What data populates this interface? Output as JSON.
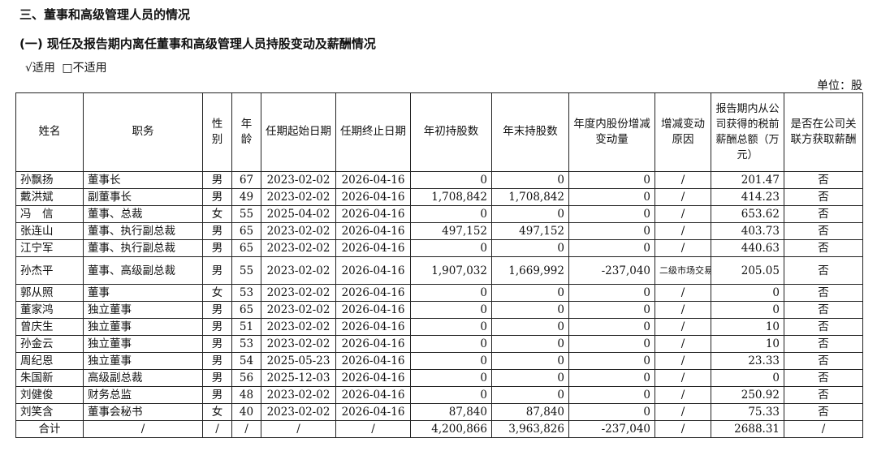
{
  "section_title": "三、董事和高级管理人员的情况",
  "subsection_title": "(一) 现任及报告期内离任董事和高级管理人员持股变动及薪酬情况",
  "applicability": {
    "applicable": "√适用",
    "not_applicable": "□不适用"
  },
  "unit_label": "单位：股",
  "table": {
    "headers": [
      "姓名",
      "职务",
      "性别",
      "年龄",
      "任期起始日期",
      "任期终止日期",
      "年初持股数",
      "年末持股数",
      "年度内股份增减变动量",
      "增减变动原因",
      "报告期内从公司获得的税前薪酬总额（万元）",
      "是否在公司关联方获取薪酬"
    ],
    "rows": [
      [
        "孙飘扬",
        "董事长",
        "男",
        "67",
        "2023-02-02",
        "2026-04-16",
        "0",
        "0",
        "0",
        "/",
        "201.47",
        "否"
      ],
      [
        "戴洪斌",
        "副董事长",
        "男",
        "49",
        "2023-02-02",
        "2026-04-16",
        "1,708,842",
        "1,708,842",
        "0",
        "/",
        "414.23",
        "否"
      ],
      [
        "冯　信",
        "董事、总裁",
        "女",
        "55",
        "2025-04-02",
        "2026-04-16",
        "0",
        "0",
        "0",
        "/",
        "653.62",
        "否"
      ],
      [
        "张连山",
        "董事、执行副总裁",
        "男",
        "65",
        "2023-02-02",
        "2026-04-16",
        "497,152",
        "497,152",
        "0",
        "/",
        "403.73",
        "否"
      ],
      [
        "江宁军",
        "董事、执行副总裁",
        "男",
        "65",
        "2023-02-02",
        "2026-04-16",
        "0",
        "0",
        "0",
        "/",
        "440.63",
        "否"
      ],
      [
        "孙杰平",
        "董事、高级副总裁",
        "男",
        "55",
        "2023-02-02",
        "2026-04-16",
        "1,907,032",
        "1,669,992",
        "-237,040",
        "二级市场交易",
        "205.05",
        "否"
      ],
      [
        "郭从照",
        "董事",
        "女",
        "53",
        "2023-02-02",
        "2026-04-16",
        "0",
        "0",
        "0",
        "/",
        "0",
        "否"
      ],
      [
        "董家鸿",
        "独立董事",
        "男",
        "65",
        "2023-02-02",
        "2026-04-16",
        "0",
        "0",
        "0",
        "/",
        "0",
        "否"
      ],
      [
        "曾庆生",
        "独立董事",
        "男",
        "51",
        "2023-02-02",
        "2026-04-16",
        "0",
        "0",
        "0",
        "/",
        "10",
        "否"
      ],
      [
        "孙金云",
        "独立董事",
        "男",
        "53",
        "2023-02-02",
        "2026-04-16",
        "0",
        "0",
        "0",
        "/",
        "10",
        "否"
      ],
      [
        "周纪恩",
        "独立董事",
        "男",
        "54",
        "2025-05-23",
        "2026-04-16",
        "0",
        "0",
        "0",
        "/",
        "23.33",
        "否"
      ],
      [
        "朱国新",
        "高级副总裁",
        "男",
        "56",
        "2025-12-03",
        "2026-04-16",
        "0",
        "0",
        "0",
        "/",
        "0",
        "否"
      ],
      [
        "刘健俊",
        "财务总监",
        "男",
        "48",
        "2023-02-02",
        "2026-04-16",
        "0",
        "0",
        "0",
        "/",
        "250.92",
        "否"
      ],
      [
        "刘笑含",
        "董事会秘书",
        "女",
        "40",
        "2023-02-02",
        "2026-04-16",
        "87,840",
        "87,840",
        "0",
        "/",
        "75.33",
        "否"
      ]
    ],
    "total_row": [
      "合计",
      "/",
      "/",
      "/",
      "/",
      "/",
      "4,200,866",
      "3,963,826",
      "-237,040",
      "/",
      "2688.31",
      "/"
    ]
  }
}
